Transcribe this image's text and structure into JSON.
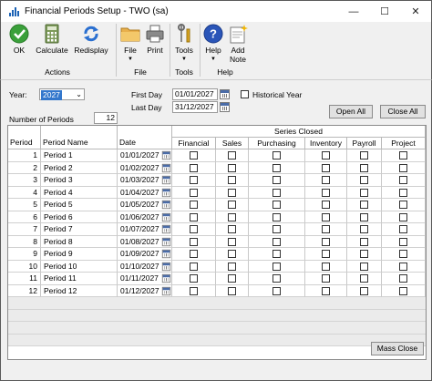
{
  "window": {
    "title": "Financial Periods Setup  -  TWO (sa)",
    "minimize": "—",
    "maximize": "☐",
    "close": "✕"
  },
  "ribbon": {
    "buttons": {
      "ok": "OK",
      "calculate": "Calculate",
      "redisplay": "Redisplay",
      "file": "File",
      "print": "Print",
      "tools": "Tools",
      "help": "Help",
      "add_note_1": "Add",
      "add_note_2": "Note"
    },
    "groups": {
      "actions": "Actions",
      "file": "File",
      "tools": "Tools",
      "help": "Help"
    }
  },
  "form": {
    "year_label": "Year:",
    "year_value": "2027",
    "first_day_label": "First Day",
    "first_day_value": "01/01/2027",
    "last_day_label": "Last Day",
    "last_day_value": "31/12/2027",
    "historical_year_label": "Historical Year",
    "periods_label": "Number of Periods",
    "periods_value": "12",
    "open_all": "Open All",
    "close_all": "Close All",
    "mass_close": "Mass Close"
  },
  "grid": {
    "series_closed": "Series Closed",
    "headers": [
      "Period",
      "Period Name",
      "Date",
      "Financial",
      "Sales",
      "Purchasing",
      "Inventory",
      "Payroll",
      "Project"
    ],
    "rows": [
      {
        "period": "1",
        "name": "Period 1",
        "date": "01/01/2027"
      },
      {
        "period": "2",
        "name": "Period 2",
        "date": "01/02/2027"
      },
      {
        "period": "3",
        "name": "Period 3",
        "date": "01/03/2027"
      },
      {
        "period": "4",
        "name": "Period 4",
        "date": "01/04/2027"
      },
      {
        "period": "5",
        "name": "Period 5",
        "date": "01/05/2027"
      },
      {
        "period": "6",
        "name": "Period 6",
        "date": "01/06/2027"
      },
      {
        "period": "7",
        "name": "Period 7",
        "date": "01/07/2027"
      },
      {
        "period": "8",
        "name": "Period 8",
        "date": "01/08/2027"
      },
      {
        "period": "9",
        "name": "Period 9",
        "date": "01/09/2027"
      },
      {
        "period": "10",
        "name": "Period 10",
        "date": "01/10/2027"
      },
      {
        "period": "11",
        "name": "Period 11",
        "date": "01/11/2027"
      },
      {
        "period": "12",
        "name": "Period 12",
        "date": "01/12/2027"
      }
    ]
  },
  "colors": {
    "selection": "#3377cc",
    "ok_green": "#3aa03a",
    "help_blue": "#2a55b8"
  }
}
